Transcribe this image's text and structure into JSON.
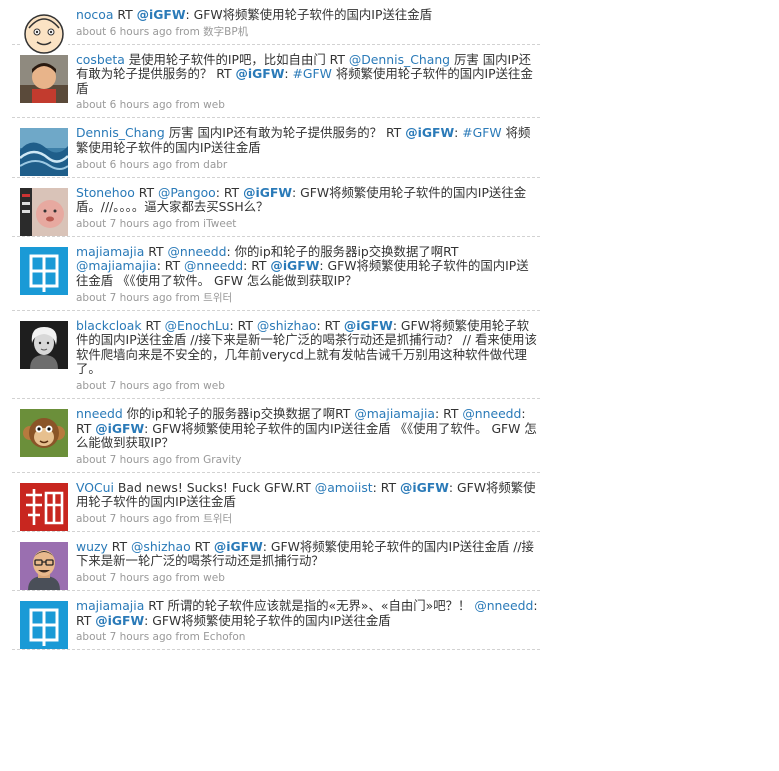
{
  "colors": {
    "link": "#2a7ab8",
    "text": "#333333",
    "meta": "#999999",
    "divider": "#d2d2d2"
  },
  "tweets": [
    {
      "avatar_icon": "cartoon-face-icon",
      "segments": [
        {
          "t": "user",
          "v": "nocoa"
        },
        {
          "t": "plain",
          "v": " RT "
        },
        {
          "t": "me",
          "v": "@iGFW"
        },
        {
          "t": "plain",
          "v": ": GFW将频繁使用轮子软件的国内IP送往金盾"
        }
      ],
      "time": "about 6 hours ago",
      "from": "from",
      "source": "数字BP机"
    },
    {
      "avatar_icon": "child-photo-icon",
      "segments": [
        {
          "t": "user",
          "v": "cosbeta"
        },
        {
          "t": "plain",
          "v": " 是使用轮子软件的IP吧，比如自由门 RT "
        },
        {
          "t": "mention",
          "v": "@Dennis_Chang"
        },
        {
          "t": "plain",
          "v": " 厉害 国内IP还有敢为轮子提供服务的？ RT "
        },
        {
          "t": "me",
          "v": "@iGFW"
        },
        {
          "t": "plain",
          "v": ": "
        },
        {
          "t": "tag",
          "v": "#GFW"
        },
        {
          "t": "plain",
          "v": " 将频繁使用轮子软件的国内IP送往金盾"
        }
      ],
      "time": "about 6 hours ago",
      "from": "from",
      "source": "web"
    },
    {
      "avatar_icon": "ocean-wave-icon",
      "segments": [
        {
          "t": "user",
          "v": "Dennis_Chang"
        },
        {
          "t": "plain",
          "v": " 厉害 国内IP还有敢为轮子提供服务的？ RT "
        },
        {
          "t": "me",
          "v": "@iGFW"
        },
        {
          "t": "plain",
          "v": ": "
        },
        {
          "t": "tag",
          "v": "#GFW"
        },
        {
          "t": "plain",
          "v": " 将频繁使用轮子软件的国内IP送往金盾"
        }
      ],
      "time": "about 6 hours ago",
      "from": "from",
      "source": "dabr"
    },
    {
      "avatar_icon": "baby-photo-icon",
      "segments": [
        {
          "t": "user",
          "v": "Stonehoo"
        },
        {
          "t": "plain",
          "v": " RT "
        },
        {
          "t": "mention",
          "v": "@Pangoo"
        },
        {
          "t": "plain",
          "v": ": RT "
        },
        {
          "t": "me",
          "v": "@iGFW"
        },
        {
          "t": "plain",
          "v": ": GFW将频繁使用轮子软件的国内IP送往金盾。///。。。。逼大家都去买SSH么？"
        }
      ],
      "time": "about 7 hours ago",
      "from": "from",
      "source": "iTweet"
    },
    {
      "avatar_icon": "jia-character-icon",
      "segments": [
        {
          "t": "user",
          "v": "majiamajia"
        },
        {
          "t": "plain",
          "v": " RT "
        },
        {
          "t": "mention",
          "v": "@nneedd"
        },
        {
          "t": "plain",
          "v": ": 你的ip和轮子的服务器ip交换数据了啊RT "
        },
        {
          "t": "mention",
          "v": "@majiamajia"
        },
        {
          "t": "plain",
          "v": ": RT "
        },
        {
          "t": "mention",
          "v": "@nneedd"
        },
        {
          "t": "plain",
          "v": ": RT "
        },
        {
          "t": "me",
          "v": "@iGFW"
        },
        {
          "t": "plain",
          "v": ": GFW将频繁使用轮子软件的国内IP送往金盾 《《使用了软件。 GFW 怎么能做到获取IP？"
        }
      ],
      "time": "about 7 hours ago",
      "from": "from",
      "source": "트위터"
    },
    {
      "avatar_icon": "portrait-photo-icon",
      "segments": [
        {
          "t": "user",
          "v": "blackcloak"
        },
        {
          "t": "plain",
          "v": " RT "
        },
        {
          "t": "mention",
          "v": "@EnochLu"
        },
        {
          "t": "plain",
          "v": ": RT "
        },
        {
          "t": "mention",
          "v": "@shizhao"
        },
        {
          "t": "plain",
          "v": ": RT "
        },
        {
          "t": "me",
          "v": "@iGFW"
        },
        {
          "t": "plain",
          "v": ": GFW将频繁使用轮子软件的国内IP送往金盾 //接下来是新一轮广泛的喝茶行动还是抓捕行动？ // 看来使用该软件爬墙向来是不安全的，几年前verycd上就有发帖告诫千万别用这种软件做代理了。"
        }
      ],
      "time": "about 7 hours ago",
      "from": "from",
      "source": "web"
    },
    {
      "avatar_icon": "monkey-icon",
      "segments": [
        {
          "t": "user",
          "v": "nneedd"
        },
        {
          "t": "plain",
          "v": " 你的ip和轮子的服务器ip交换数据了啊RT "
        },
        {
          "t": "mention",
          "v": "@majiamajia"
        },
        {
          "t": "plain",
          "v": ": RT "
        },
        {
          "t": "mention",
          "v": "@nneedd"
        },
        {
          "t": "plain",
          "v": ": RT "
        },
        {
          "t": "me",
          "v": "@iGFW"
        },
        {
          "t": "plain",
          "v": ": GFW将频繁使用轮子软件的国内IP送往金盾 《《使用了软件。 GFW 怎么能做到获取IP？"
        }
      ],
      "time": "about 7 hours ago",
      "from": "from",
      "source": "Gravity"
    },
    {
      "avatar_icon": "fan-character-icon",
      "segments": [
        {
          "t": "user",
          "v": "VOCui"
        },
        {
          "t": "plain",
          "v": " Bad news! Sucks! Fuck GFW.RT "
        },
        {
          "t": "mention",
          "v": "@amoiist"
        },
        {
          "t": "plain",
          "v": ": RT "
        },
        {
          "t": "me",
          "v": "@iGFW"
        },
        {
          "t": "plain",
          "v": ": GFW将频繁使用轮子软件的国内IP送往金盾"
        }
      ],
      "time": "about 7 hours ago",
      "from": "from",
      "source": "트위터"
    },
    {
      "avatar_icon": "cartoon-man-icon",
      "segments": [
        {
          "t": "user",
          "v": "wuzy"
        },
        {
          "t": "plain",
          "v": " RT "
        },
        {
          "t": "mention",
          "v": "@shizhao"
        },
        {
          "t": "plain",
          "v": " RT "
        },
        {
          "t": "me",
          "v": "@iGFW"
        },
        {
          "t": "plain",
          "v": ": GFW将频繁使用轮子软件的国内IP送往金盾 //接下来是新一轮广泛的喝茶行动还是抓捕行动？"
        }
      ],
      "time": "about 7 hours ago",
      "from": "from",
      "source": "web"
    },
    {
      "avatar_icon": "jia-character-icon",
      "segments": [
        {
          "t": "user",
          "v": "majiamajia"
        },
        {
          "t": "plain",
          "v": " RT 所谓的轮子软件应该就是指的«无界»、«自由门»吧？！ "
        },
        {
          "t": "mention",
          "v": "@nneedd"
        },
        {
          "t": "plain",
          "v": ": RT "
        },
        {
          "t": "me",
          "v": "@iGFW"
        },
        {
          "t": "plain",
          "v": ": GFW将频繁使用轮子软件的国内IP送往金盾"
        }
      ],
      "time": "about 7 hours ago",
      "from": "from",
      "source": "Echofon"
    }
  ]
}
